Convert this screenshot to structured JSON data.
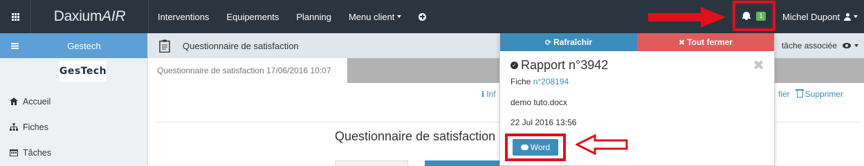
{
  "topbar": {
    "brand_main": "Daxium",
    "brand_air": " AIR",
    "nav": [
      {
        "label": "Interventions"
      },
      {
        "label": "Equipements"
      },
      {
        "label": "Planning"
      },
      {
        "label": "Menu client"
      }
    ],
    "notification_count": "1",
    "user_name": "Michel Dupont",
    "icons": [
      "grid-icon",
      "plus-circle-icon",
      "bell-icon",
      "user-icon"
    ]
  },
  "sidebar": {
    "title": "Gestech",
    "logo_text": "GesTech",
    "items": [
      {
        "label": "Accueil",
        "icon": "home-icon"
      },
      {
        "label": "Fiches",
        "icon": "sitemap-icon"
      },
      {
        "label": "Tâches",
        "icon": "calendar-icon"
      }
    ]
  },
  "main": {
    "subheader_title": "Questionnaire de satisfaction",
    "assoc_label": "tâche associée",
    "tab_label": "Questionnaire de satisfaction 17/06/2016 10:07",
    "info_label": "Inf",
    "edit_label": "fier",
    "delete_label": "Supprimer",
    "form_title": "Questionnaire de satisfaction"
  },
  "dropdown": {
    "refresh_label": "Rafraîchir",
    "close_all_label": "Tout fermer",
    "report_title": "Rapport n°3942",
    "fiche_label": "Fiche",
    "fiche_link": "n°208194",
    "document": "demo tuto.docx",
    "date": "22 Jul 2016 13:56",
    "word_button": "Word"
  },
  "colors": {
    "navbar": "#2a3540",
    "sidebar_header": "#5d9fd6",
    "primary": "#3c8dbc",
    "danger": "#e05c5c",
    "badge": "#5cb85c",
    "annotation_red": "#e0101a"
  }
}
